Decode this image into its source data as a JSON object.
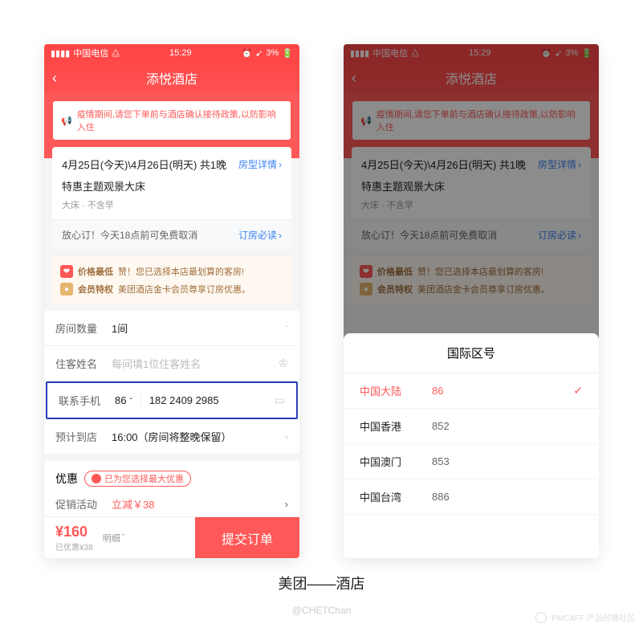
{
  "statusbar": {
    "carrier": "中国电信",
    "wifi": "⧋",
    "time": "15:29",
    "battery": "3%",
    "battery_icon": "🔋",
    "alarm": "⏰",
    "loc": "➹",
    "signal": "▮▮▮▮"
  },
  "nav": {
    "title": "添悦酒店",
    "back": "‹"
  },
  "notice": {
    "icon": "📢",
    "text": "疫情期间,请您下单前与酒店确认接待政策,以防影响入住"
  },
  "booking": {
    "date_text": "4月25日(今天)\\4月26日(明天) 共1晚",
    "room_link": "房型详情",
    "room_name": "特惠主题观景大床",
    "room_sub": "大床 · 不含早",
    "policy": "放心订！今天18点前可免费取消",
    "policy_link": "订房必读"
  },
  "perks": [
    {
      "badge": "❤",
      "title": "价格最低",
      "text": "赞！您已选择本店最划算的客房!"
    },
    {
      "badge": "●",
      "title": "会员特权",
      "text": "美团酒店金卡会员尊享订房优惠。"
    }
  ],
  "form": {
    "rooms": {
      "label": "房间数量",
      "value": "1间"
    },
    "guest": {
      "label": "住客姓名",
      "placeholder": "每间填1位住客姓名"
    },
    "phone": {
      "label": "联系手机",
      "code": "86",
      "value": "182 2409 2985"
    },
    "arrival": {
      "label": "预计到店",
      "value": "16:00（房间将整晚保留）"
    }
  },
  "discount": {
    "title": "优惠",
    "badge": "已为您选择最大优惠",
    "promo_label": "促销活动",
    "promo_value": "立减￥38"
  },
  "bottom": {
    "price": "¥160",
    "saved": "已优惠¥38",
    "detail": "明细",
    "submit": "提交订单"
  },
  "sheet": {
    "title": "国际区号",
    "rows": [
      {
        "country": "中国大陆",
        "code": "86",
        "selected": true
      },
      {
        "country": "中国香港",
        "code": "852",
        "selected": false
      },
      {
        "country": "中国澳门",
        "code": "853",
        "selected": false
      },
      {
        "country": "中国台湾",
        "code": "886",
        "selected": false
      }
    ]
  },
  "caption": "美团——酒店",
  "credit": "@CHETChan",
  "watermark": "PMCAFF 产品经理社区"
}
